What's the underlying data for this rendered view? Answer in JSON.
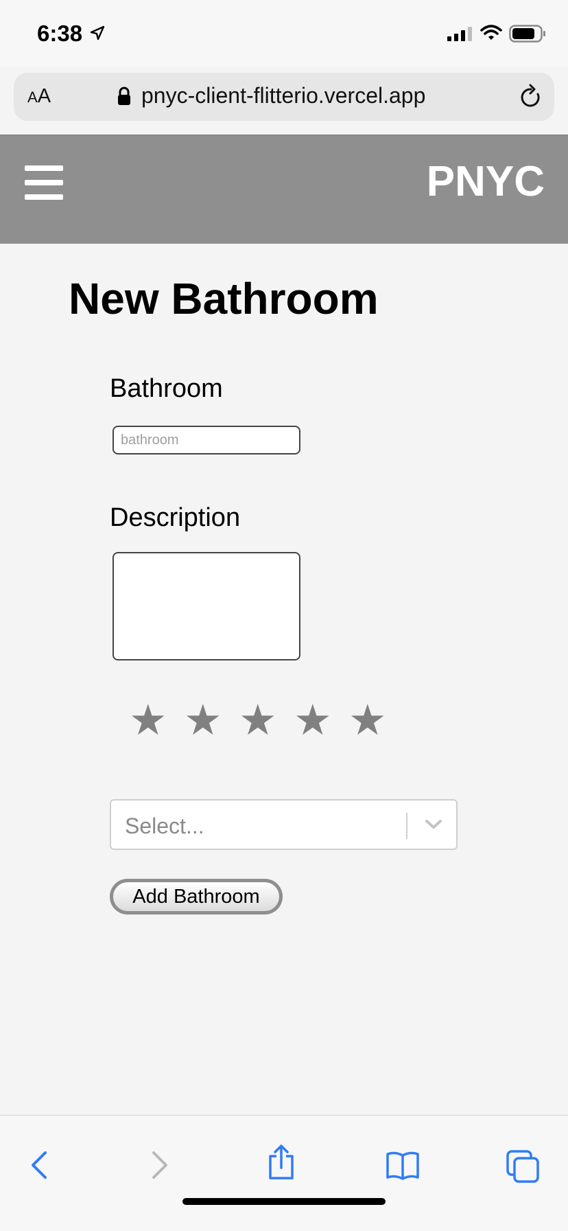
{
  "status_bar": {
    "time": "6:38"
  },
  "browser": {
    "aa_label_small": "A",
    "aa_label_large": "A",
    "url": "pnyc-client-flitterio.vercel.app"
  },
  "header": {
    "brand": "PNYC"
  },
  "form": {
    "title": "New Bathroom",
    "bathroom_label": "Bathroom",
    "bathroom_placeholder": "bathroom",
    "bathroom_value": "",
    "description_label": "Description",
    "description_value": "",
    "rating": {
      "filled": 0,
      "max": 5,
      "star_glyph": "★"
    },
    "select_placeholder": "Select...",
    "submit_label": "Add Bathroom"
  },
  "icons": {
    "status": [
      "location-arrow-icon",
      "signal-icon",
      "wifi-icon",
      "battery-icon"
    ],
    "browser": [
      "lock-icon",
      "reload-icon"
    ],
    "toolbar": [
      "back-icon",
      "forward-icon",
      "share-icon",
      "bookmarks-icon",
      "tabs-icon"
    ]
  },
  "colors": {
    "header_bg": "#8f8f8f",
    "page_bg": "#f4f4f4",
    "star": "#808080",
    "toolbar_active": "#2f7cf6",
    "toolbar_disabled": "#b8b8b8"
  }
}
